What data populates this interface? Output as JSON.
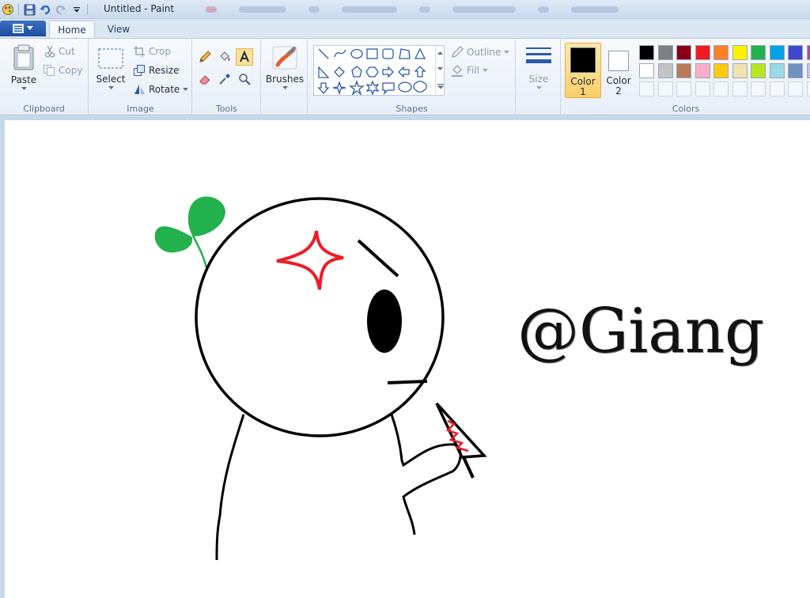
{
  "window": {
    "title": "Untitled - Paint"
  },
  "tabs": [
    {
      "label": "Home"
    },
    {
      "label": "View"
    }
  ],
  "ribbon": {
    "clipboard": {
      "group": "Clipboard",
      "paste": "Paste",
      "cut": "Cut",
      "copy": "Copy"
    },
    "image": {
      "group": "Image",
      "select": "Select",
      "crop": "Crop",
      "resize": "Resize",
      "rotate": "Rotate"
    },
    "tools": {
      "group": "Tools"
    },
    "brushes": {
      "label": "Brushes"
    },
    "shapes": {
      "group": "Shapes",
      "outline": "Outline",
      "fill": "Fill"
    },
    "size": {
      "label": "Size"
    },
    "color1": {
      "label_line1": "Color",
      "label_line2": "1",
      "value": "#000000"
    },
    "color2": {
      "label_line1": "Color",
      "label_line2": "2",
      "value": "#ffffff"
    },
    "colors": {
      "group": "Colors",
      "row1": [
        "#000000",
        "#7f7f7f",
        "#880015",
        "#ed1c24",
        "#ff7f27",
        "#fff200",
        "#22b14c",
        "#00a2e8",
        "#3f48cc",
        "#a349a4"
      ],
      "row2": [
        "#ffffff",
        "#c3c3c3",
        "#b97a57",
        "#ffaec9",
        "#ffc90e",
        "#efe4b0",
        "#b5e61d",
        "#99d9ea",
        "#7092be",
        "#c8bfe7"
      ]
    }
  },
  "canvas": {
    "text": "@Giang",
    "colors": {
      "stroke": "#000000",
      "sprout": "#22b14c",
      "mark": "#ed1c24"
    }
  }
}
